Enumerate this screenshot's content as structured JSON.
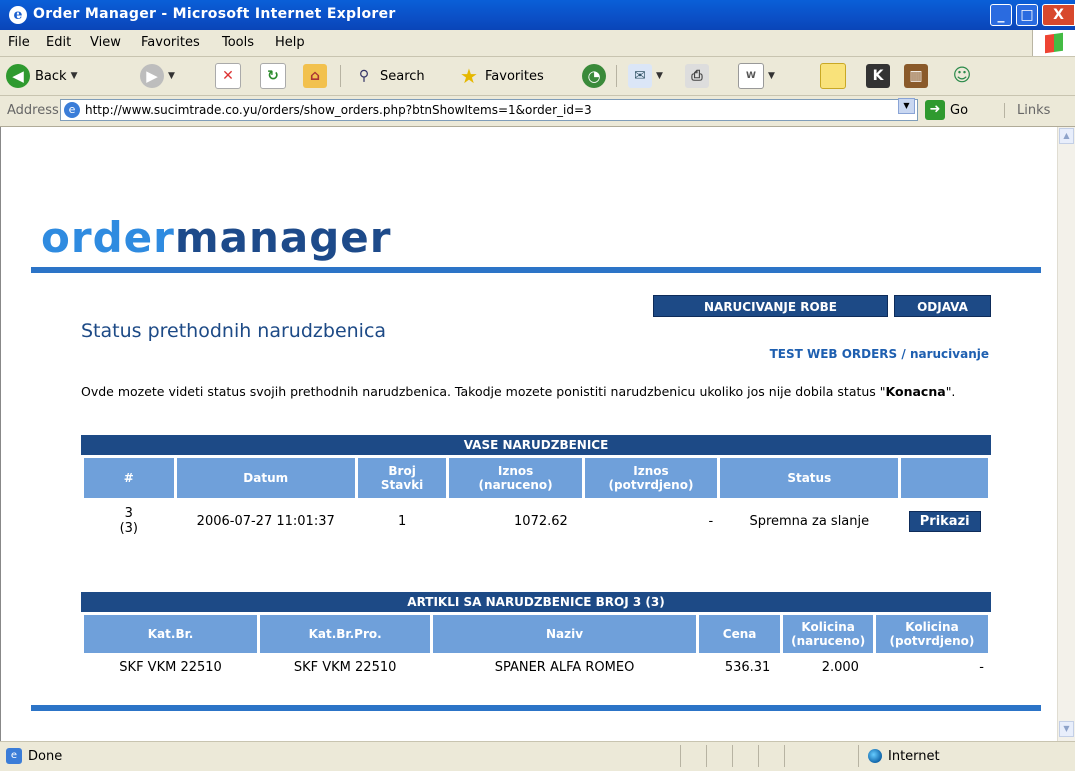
{
  "window": {
    "title": "Order Manager - Microsoft Internet Explorer",
    "minimize": "_",
    "maximize": "□",
    "close": "X"
  },
  "menu": [
    "File",
    "Edit",
    "View",
    "Favorites",
    "Tools",
    "Help"
  ],
  "toolbar": {
    "back": "Back",
    "search": "Search",
    "favorites": "Favorites"
  },
  "address": {
    "label": "Address",
    "url": "http://www.sucimtrade.co.yu/orders/show_orders.php?btnShowItems=1&order_id=3",
    "go": "Go",
    "links": "Links"
  },
  "page": {
    "logo_part1": "order",
    "logo_part2": "manager",
    "nav": {
      "order_goods": "NARUCIVANJE ROBE",
      "logout": "ODJAVA"
    },
    "heading": "Status prethodnih narudzbenica",
    "user": "TEST WEB ORDERS",
    "user_sep": " / ",
    "user_link": "narucivanje",
    "description_pre": "Ovde mozete videti status svojih prethodnih narudzbenica. Takodje mozete ponistiti narudzbenicu ukoliko jos nije dobila status \"",
    "description_bold": "Konacna",
    "description_post": "\"."
  },
  "orders": {
    "caption": "VASE NARUDZBENICE",
    "headers": {
      "num": "#",
      "date": "Datum",
      "items_l1": "Broj",
      "items_l2": "Stavki",
      "amount_ordered_l1": "Iznos",
      "amount_ordered_l2": "(naruceno)",
      "amount_confirmed_l1": "Iznos",
      "amount_confirmed_l2": "(potvrdjeno)",
      "status": "Status"
    },
    "rows": [
      {
        "num": "3",
        "num_sub": "(3)",
        "date": "2006-07-27 11:01:37",
        "items": "1",
        "amount_ordered": "1072.62",
        "amount_confirmed": "-",
        "status": "Spremna za slanje",
        "action": "Prikazi"
      }
    ]
  },
  "items": {
    "caption": "ARTIKLI SA NARUDZBENICE BROJ 3 (3)",
    "headers": {
      "cat": "Kat.Br.",
      "cat_pro": "Kat.Br.Pro.",
      "name": "Naziv",
      "price": "Cena",
      "qty_ordered_l1": "Kolicina",
      "qty_ordered_l2": "(naruceno)",
      "qty_confirmed_l1": "Kolicina",
      "qty_confirmed_l2": "(potvrdjeno)"
    },
    "rows": [
      {
        "cat": "SKF VKM 22510",
        "cat_pro": "SKF VKM 22510",
        "name": "SPANER ALFA ROMEO",
        "price": "536.31",
        "qty_ordered": "2.000",
        "qty_confirmed": "-"
      }
    ]
  },
  "status_bar": {
    "text": "Done",
    "zone": "Internet"
  }
}
